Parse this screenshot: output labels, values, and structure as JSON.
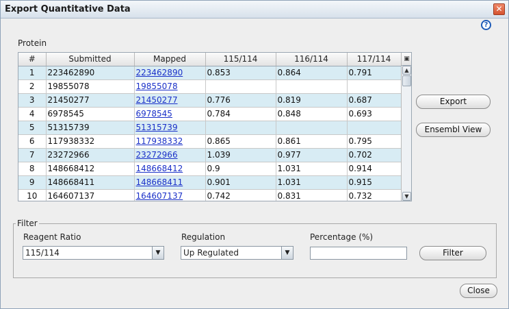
{
  "window": {
    "title": "Export Quantitative Data",
    "close_glyph": "✕",
    "help_glyph": "?"
  },
  "protein_label": "Protein",
  "table": {
    "columns": [
      "#",
      "Submitted",
      "Mapped",
      "115/114",
      "116/114",
      "117/114"
    ],
    "rows": [
      {
        "n": "1",
        "submitted": "223462890",
        "mapped": "223462890",
        "r115": "0.853",
        "r116": "0.864",
        "r117": "0.791"
      },
      {
        "n": "2",
        "submitted": "19855078",
        "mapped": "19855078",
        "r115": "",
        "r116": "",
        "r117": ""
      },
      {
        "n": "3",
        "submitted": "21450277",
        "mapped": "21450277",
        "r115": "0.776",
        "r116": "0.819",
        "r117": "0.687"
      },
      {
        "n": "4",
        "submitted": "6978545",
        "mapped": "6978545",
        "r115": "0.784",
        "r116": "0.848",
        "r117": "0.693"
      },
      {
        "n": "5",
        "submitted": "51315739",
        "mapped": "51315739",
        "r115": "",
        "r116": "",
        "r117": ""
      },
      {
        "n": "6",
        "submitted": "117938332",
        "mapped": "117938332",
        "r115": "0.865",
        "r116": "0.861",
        "r117": "0.795"
      },
      {
        "n": "7",
        "submitted": "23272966",
        "mapped": "23272966",
        "r115": "1.039",
        "r116": "0.977",
        "r117": "0.702"
      },
      {
        "n": "8",
        "submitted": "148668412",
        "mapped": "148668412",
        "r115": "0.9",
        "r116": "1.031",
        "r117": "0.914"
      },
      {
        "n": "9",
        "submitted": "148668411",
        "mapped": "148668411",
        "r115": "0.901",
        "r116": "1.031",
        "r117": "0.915"
      },
      {
        "n": "10",
        "submitted": "164607137",
        "mapped": "164607137",
        "r115": "0.742",
        "r116": "0.831",
        "r117": "0.732"
      }
    ]
  },
  "buttons": {
    "export": "Export",
    "ensembl_view": "Ensembl View",
    "filter": "Filter",
    "close": "Close"
  },
  "filter": {
    "legend": "Filter",
    "reagent_ratio_label": "Reagent Ratio",
    "reagent_ratio_value": "115/114",
    "regulation_label": "Regulation",
    "regulation_value": "Up Regulated",
    "percentage_label": "Percentage (%)",
    "percentage_value": ""
  },
  "icons": {
    "help": "help-icon",
    "close": "close-icon",
    "column-chooser": "column-chooser-icon",
    "scroll-up": "scroll-up-arrow",
    "scroll-down": "scroll-down-arrow",
    "dropdown": "chevron-down-icon"
  },
  "colors": {
    "row_alt": "#d8ecf4",
    "link": "#1a30c8",
    "title_bar": "#d7e1eb",
    "close_button": "#d5532f"
  }
}
